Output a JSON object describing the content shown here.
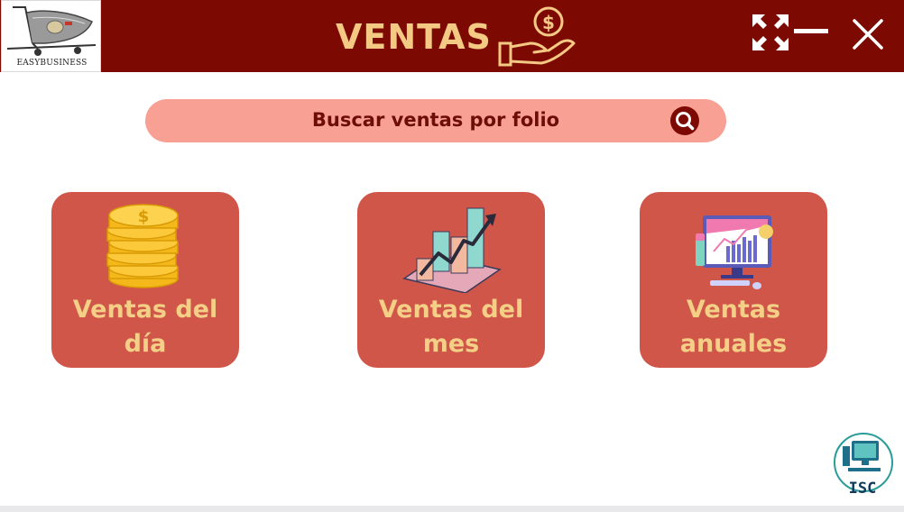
{
  "header": {
    "title": "VENTAS",
    "logo_text": "EASYBUSINESS",
    "title_icon": "hand-money-icon",
    "window_controls": [
      "expand-icon",
      "minimize-icon",
      "close-icon"
    ]
  },
  "search": {
    "label": "Buscar ventas por folio",
    "icon": "search-icon"
  },
  "cards": [
    {
      "line1": "Ventas del",
      "line2": "día",
      "icon": "coins-stack-icon"
    },
    {
      "line1": "Ventas del",
      "line2": "mes",
      "icon": "growth-chart-icon"
    },
    {
      "line1": "Ventas",
      "line2": "anuales",
      "icon": "monitor-analytics-icon"
    }
  ],
  "badge": {
    "text": "ISC"
  },
  "colors": {
    "header_bg": "#7d0a02",
    "accent_text": "#f3c984",
    "search_bg": "#f8a094",
    "card_bg": "#d0564a",
    "card_text": "#f4cf86"
  }
}
